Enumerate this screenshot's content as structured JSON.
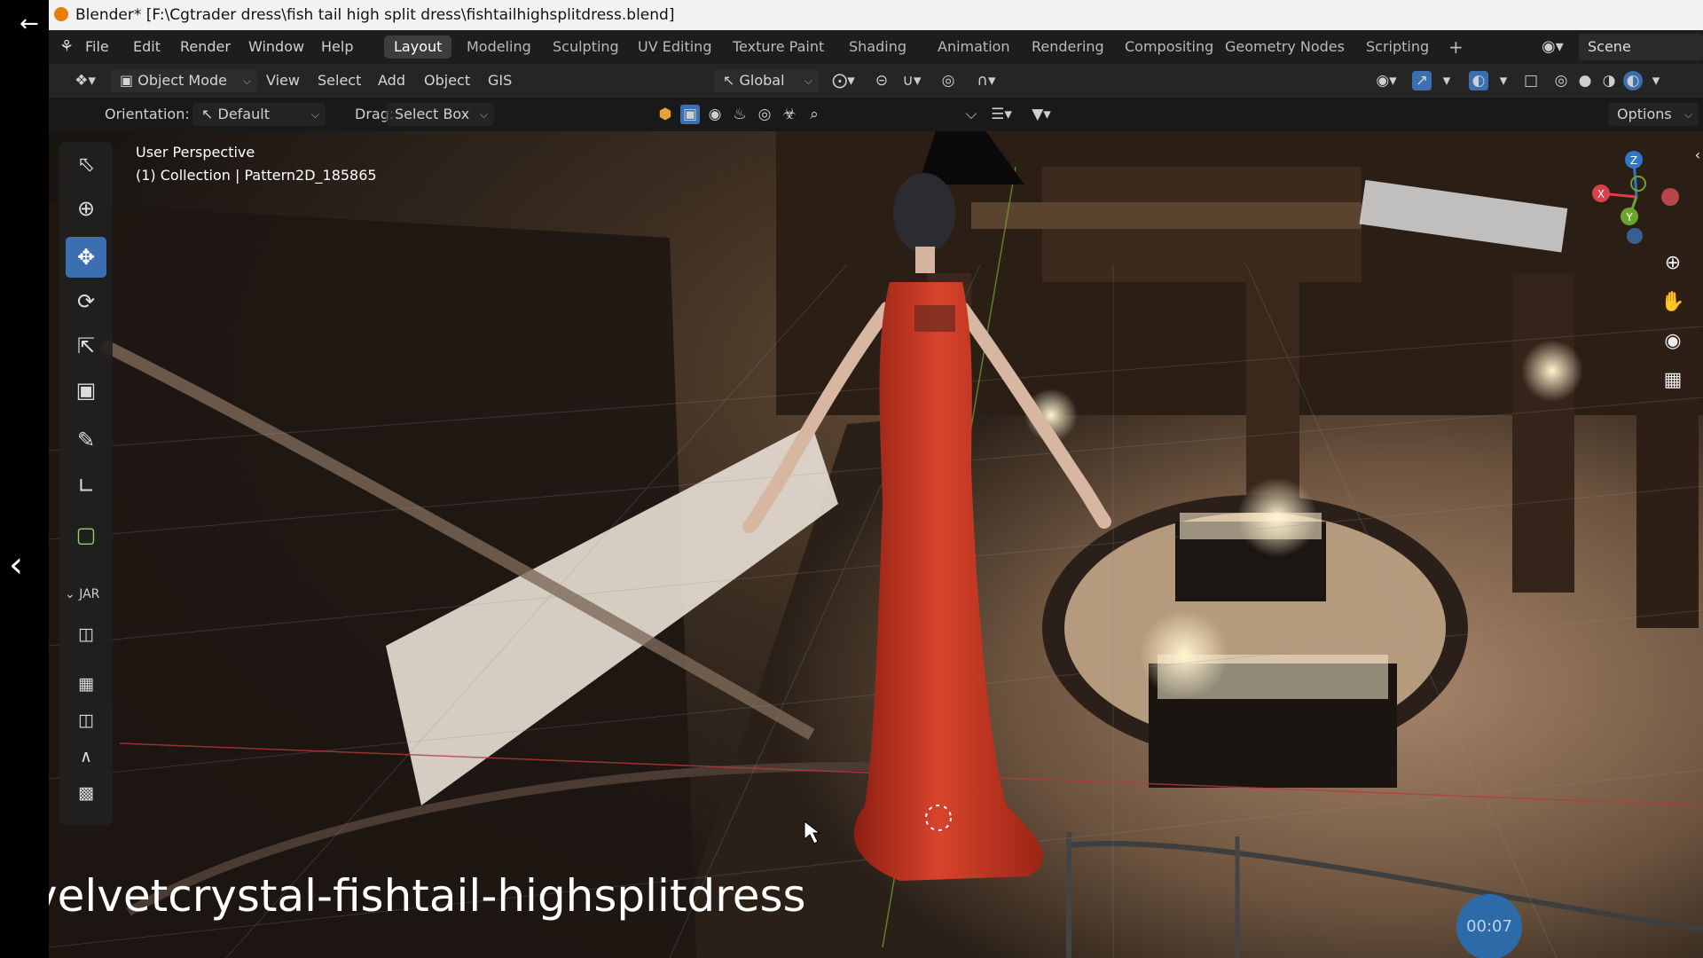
{
  "window": {
    "title": "Blender* [F:\\Cgtrader dress\\fish tail high split dress\\fishtailhighsplitdress.blend]"
  },
  "menu": [
    "File",
    "Edit",
    "Render",
    "Window",
    "Help"
  ],
  "workspace_tabs": [
    "Layout",
    "Modeling",
    "Sculpting",
    "UV Editing",
    "Texture Paint",
    "Shading",
    "Animation",
    "Rendering",
    "Compositing",
    "Geometry Nodes",
    "Scripting"
  ],
  "active_workspace": "Layout",
  "scene": {
    "label": "Scene"
  },
  "header3d": {
    "mode": "Object Mode",
    "view": "View",
    "select": "Select",
    "add": "Add",
    "object": "Object",
    "gis": "GIS",
    "transform_orientation": "Global"
  },
  "tool_settings": {
    "orientation_label": "Orientation:",
    "orientation_value": "Default",
    "drag_label": "Drag:",
    "drag_value": "Select Box",
    "options": "Options"
  },
  "viewport": {
    "perspective": "User Perspective",
    "collection_info": "(1) Collection | Pattern2D_185865"
  },
  "toolbar_panel": {
    "label": "JAR"
  },
  "overlay": {
    "watermark": "velvetcrystal-fishtail-highsplitdress",
    "timer": "00:07"
  },
  "gizmo": {
    "z": "Z",
    "x": "X",
    "y": "Y"
  },
  "colors": {
    "active_tab_bg": "#3d3d3d",
    "active_tool": "#3b6fb0",
    "dress": "#c8341f",
    "gizmo_x": "#d9404a",
    "gizmo_y": "#6aa52b",
    "gizmo_z": "#2f78c8"
  }
}
